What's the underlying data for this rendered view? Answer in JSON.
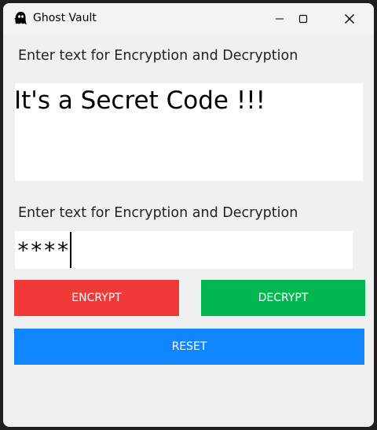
{
  "window": {
    "title": "Ghost Vault",
    "app_icon": "ghost-icon",
    "controls": [
      "minimize-icon",
      "maximize-icon",
      "close-icon"
    ]
  },
  "main": {
    "message_label": "Enter text for Encryption and Decryption",
    "message_text": "It's a Secret Code !!!",
    "key_label": "Enter text for Encryption and Decryption",
    "key_value": "****",
    "buttons": {
      "encrypt": "ENCRYPT",
      "decrypt": "DECRYPT",
      "reset": "RESET"
    }
  },
  "colors": {
    "window_bg": "#f0f0f0",
    "encrypt": "#f03a37",
    "decrypt": "#00b84f",
    "reset": "#1187ff"
  }
}
